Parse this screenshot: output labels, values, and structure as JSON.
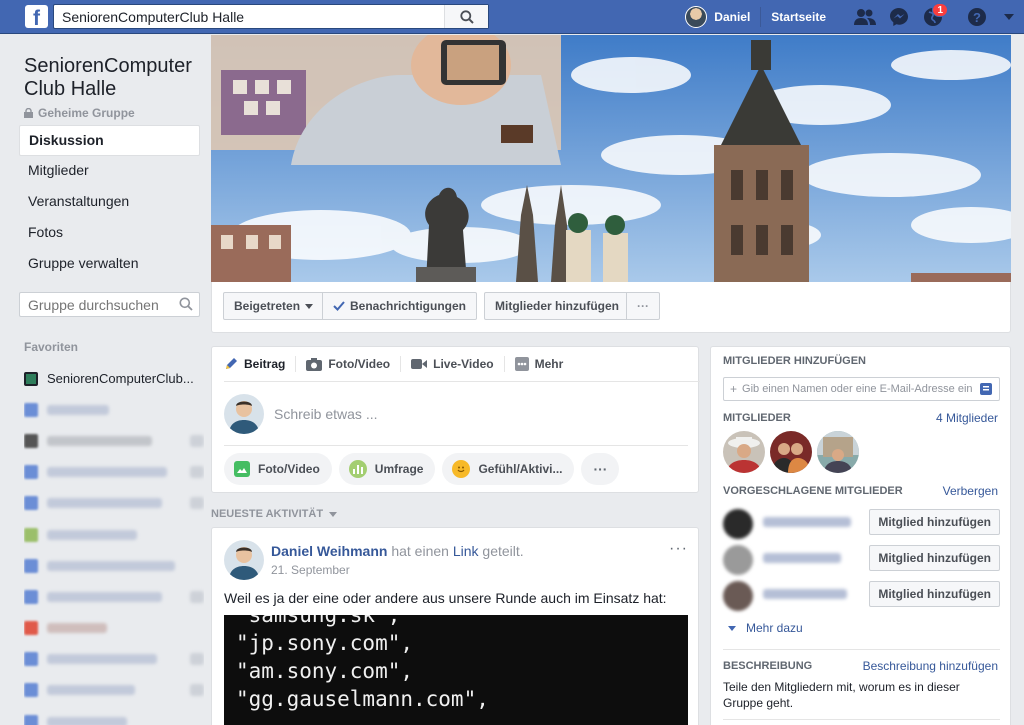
{
  "topbar": {
    "logo": "f",
    "search_value": "SeniorenComputerClub Halle",
    "user_name": "Daniel",
    "home_label": "Startseite",
    "notification_count": "1",
    "brand_color": "#4267b2"
  },
  "group": {
    "name": "SeniorenComputer Club Halle",
    "privacy": "Geheime Gruppe"
  },
  "nav": {
    "items": [
      {
        "label": "Diskussion"
      },
      {
        "label": "Mitglieder"
      },
      {
        "label": "Veranstaltungen"
      },
      {
        "label": "Fotos"
      },
      {
        "label": "Gruppe verwalten"
      }
    ]
  },
  "group_search": {
    "placeholder": "Gruppe durchsuchen"
  },
  "favorites": {
    "title": "Favoriten",
    "first_item": "SeniorenComputerClub..."
  },
  "cover_actions": {
    "joined": "Beigetreten",
    "notifications": "Benachrichtigungen",
    "add_members": "Mitglieder hinzufügen",
    "more": "···"
  },
  "composer": {
    "tabs": [
      {
        "label": "Beitrag",
        "icon": "pencil-icon"
      },
      {
        "label": "Foto/Video",
        "icon": "camera-icon"
      },
      {
        "label": "Live-Video",
        "icon": "video-icon"
      },
      {
        "label": "Mehr",
        "icon": "grid-icon"
      }
    ],
    "placeholder": "Schreib etwas ...",
    "pills": [
      {
        "label": "Foto/Video",
        "icon": "photo-icon"
      },
      {
        "label": "Umfrage",
        "icon": "poll-icon"
      },
      {
        "label": "Gefühl/Aktivi...",
        "icon": "smiley-icon"
      }
    ],
    "pill_more": "···"
  },
  "activity": {
    "header": "NEUESTE AKTIVITÄT"
  },
  "post": {
    "author": "Daniel Weihmann",
    "action_pre": "hat einen",
    "action_link": "Link",
    "action_post": "geteilt.",
    "date": "21. September",
    "text": "Weil es ja der eine oder andere aus unsere Runde auch im Einsatz hat:",
    "code_lines": [
      "\"samsung.sk\",",
      "\"jp.sony.com\",",
      "\"am.sony.com\",",
      "\"gg.gauselmann.com\","
    ],
    "more": "···"
  },
  "sidebar": {
    "add_title": "MITGLIEDER HINZUFÜGEN",
    "add_placeholder": "Gib einen Namen oder eine E-Mail-Adresse ein ...",
    "members_title": "MITGLIEDER",
    "members_count": "4 Mitglieder",
    "suggested_title": "VORGESCHLAGENE MITGLIEDER",
    "hide_label": "Verbergen",
    "add_member_label": "Mitglied hinzufügen",
    "more_label": "Mehr dazu",
    "description_title": "BESCHREIBUNG",
    "description_link": "Beschreibung hinzufügen",
    "description_text": "Teile den Mitgliedern mit, worum es in dieser Gruppe geht."
  }
}
